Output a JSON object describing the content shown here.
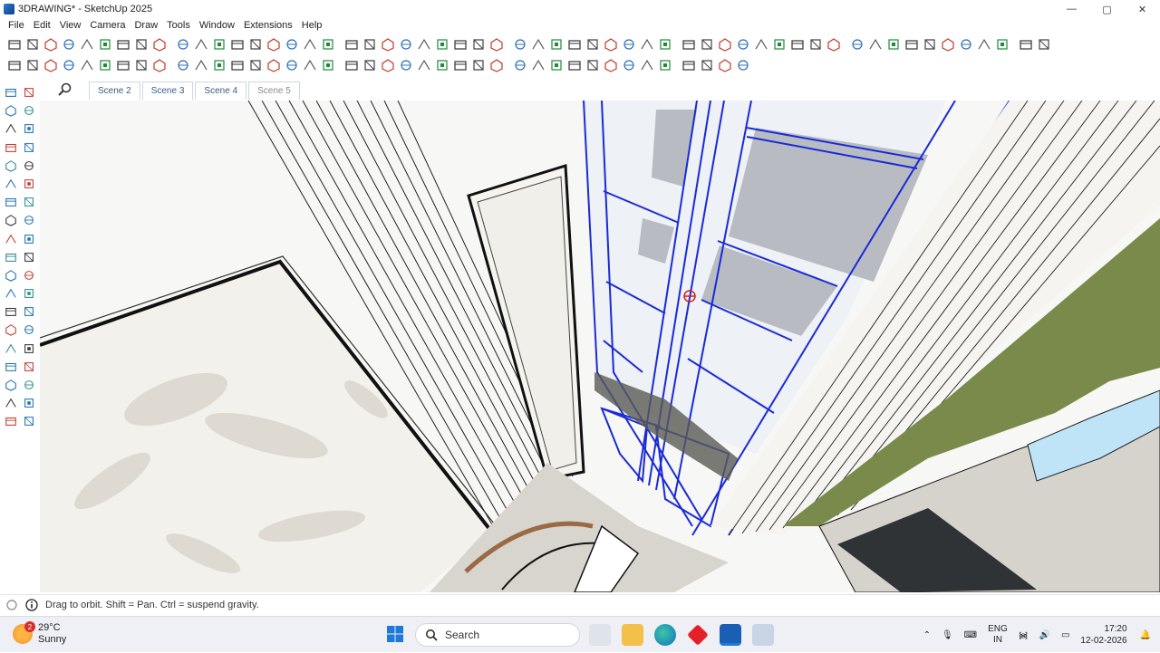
{
  "window": {
    "title": "3DRAWING* - SketchUp 2025",
    "controls": {
      "minimize": "—",
      "maximize": "▢",
      "close": "✕"
    }
  },
  "menu": [
    "File",
    "Edit",
    "View",
    "Camera",
    "Draw",
    "Tools",
    "Window",
    "Extensions",
    "Help"
  ],
  "toolbar": {
    "row1_icons": [
      "make-component-icon",
      "select-icon",
      "box-icon",
      "paint-icon",
      "eraser-icon",
      "tape-icon",
      "push-pull-icon",
      "solid-tools-icon",
      "section-plane-icon",
      "view-iso-icon",
      "view-top-icon",
      "view-front-icon",
      "view-right-icon",
      "view-back-icon",
      "view-left-icon",
      "shadows-icon",
      "fog-icon"
    ],
    "row2_icons": [
      "sandbox-icon",
      "follow-me-icon",
      "offset-icon",
      "protractor-icon",
      "axes-icon",
      "dimension-icon",
      "text-icon",
      "3d-text-icon",
      "xray-icon",
      "back-edges-icon",
      "wireframe-icon",
      "hidden-line-icon",
      "shaded-icon",
      "textured-icon",
      "monochrome-icon"
    ]
  },
  "scenes": {
    "search_icon": "magnifier-icon",
    "tabs": [
      "Scene 2",
      "Scene 3",
      "Scene 4",
      "Scene 5"
    ],
    "active_index": 3
  },
  "viewport": {
    "description_colors": {
      "selection_blue": "#1a2bd6",
      "wall_green": "#7a8a4a",
      "marble": "#d9d6d0"
    }
  },
  "status": {
    "hint": "Drag to orbit. Shift = Pan. Ctrl = suspend gravity."
  },
  "taskbar": {
    "weather_temp": "29°C",
    "weather_desc": "Sunny",
    "weather_badge": "2",
    "search_label": "Search",
    "lang_line1": "ENG",
    "lang_line2": "IN",
    "time": "17:20",
    "date": "12-02-2026"
  }
}
